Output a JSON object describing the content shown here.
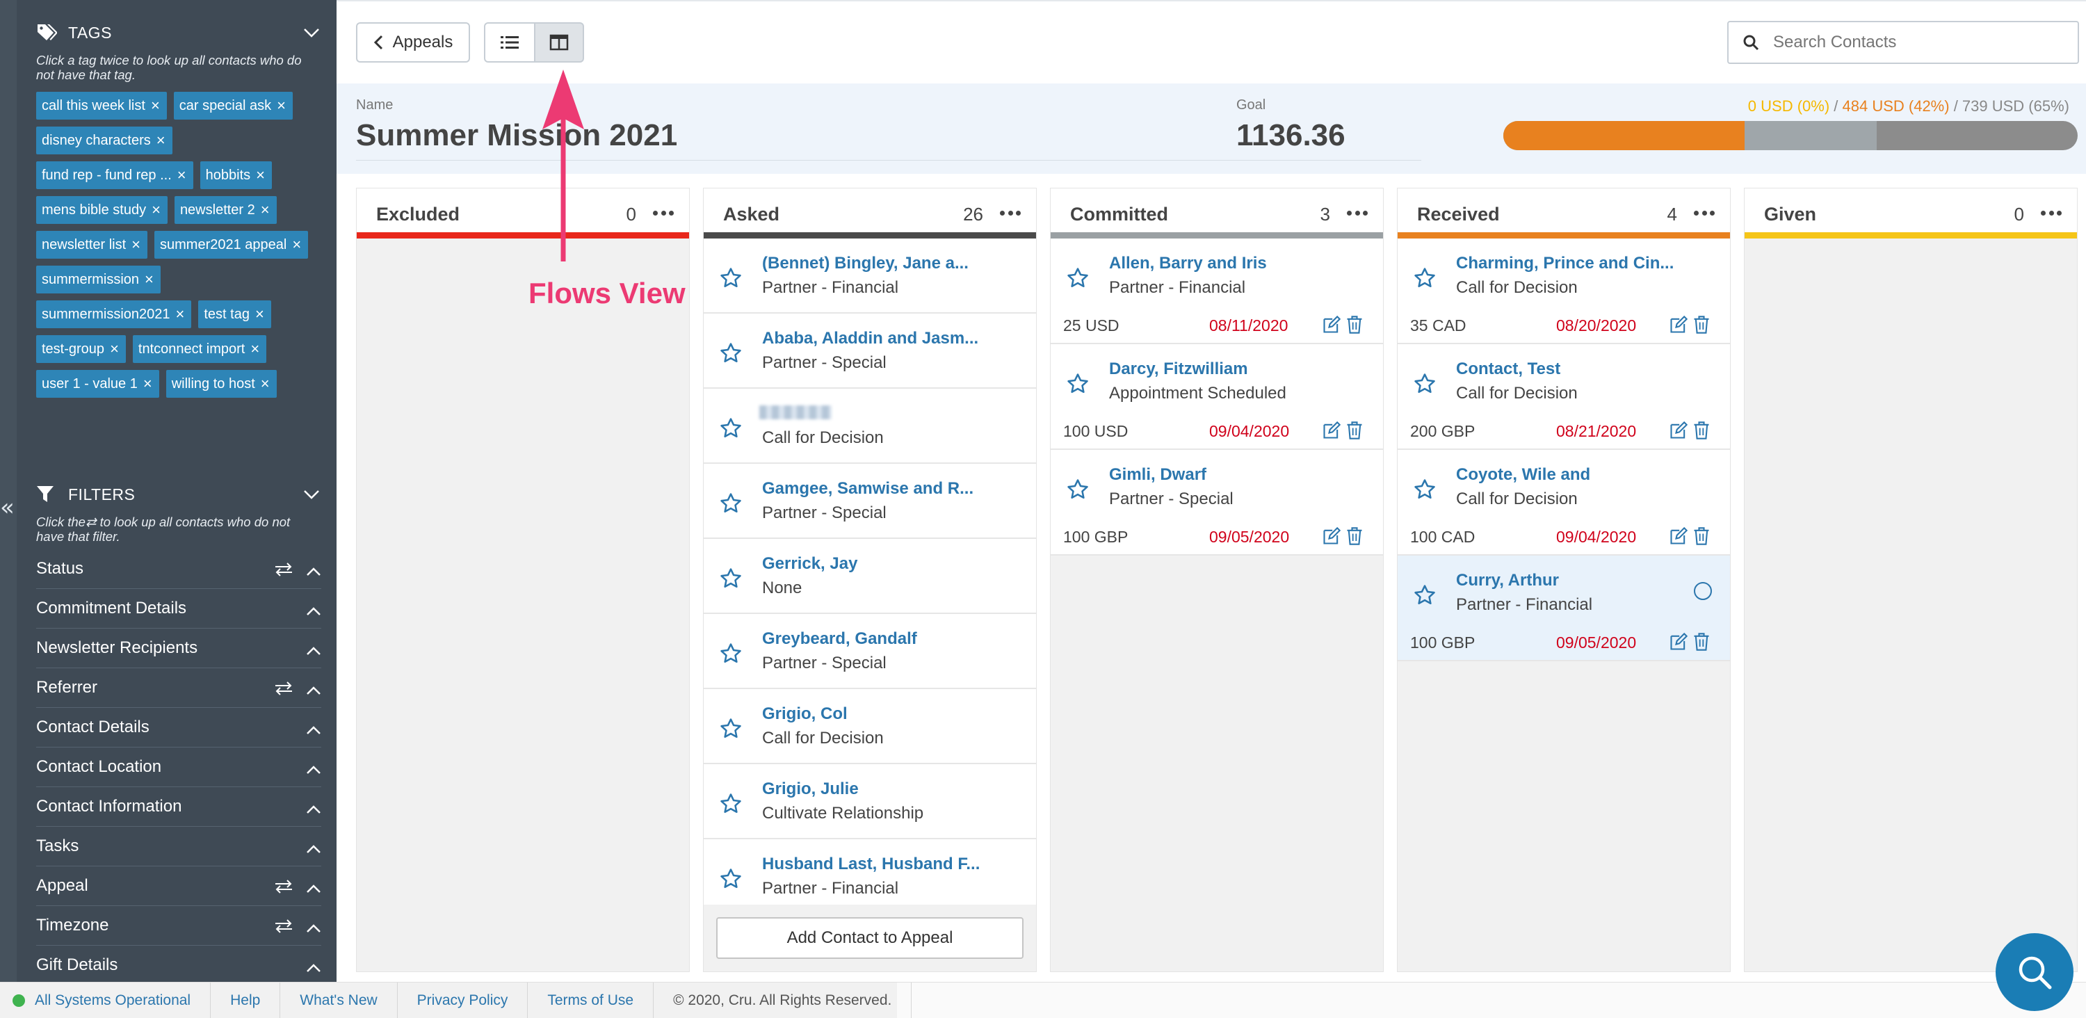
{
  "sidebar": {
    "tags_title": "TAGS",
    "tags_hint": "Click a tag twice to look up all contacts who do not have that tag.",
    "tags": [
      "call this week list",
      "car special ask",
      "disney characters",
      "fund rep - fund rep ...",
      "hobbits",
      "mens bible study",
      "newsletter 2",
      "newsletter list",
      "summer2021 appeal",
      "summermission",
      "summermission2021",
      "test tag",
      "test-group",
      "tntconnect import",
      "user 1 - value 1",
      "willing to host"
    ],
    "filters_title": "FILTERS",
    "filters_hint_prefix": "Click the",
    "filters_hint_suffix": "to look up all contacts who do not have that filter.",
    "filters": [
      {
        "label": "Status",
        "switch": true
      },
      {
        "label": "Commitment Details",
        "switch": false
      },
      {
        "label": "Newsletter Recipients",
        "switch": false
      },
      {
        "label": "Referrer",
        "switch": true
      },
      {
        "label": "Contact Details",
        "switch": false
      },
      {
        "label": "Contact Location",
        "switch": false
      },
      {
        "label": "Contact Information",
        "switch": false
      },
      {
        "label": "Tasks",
        "switch": false
      },
      {
        "label": "Appeal",
        "switch": true
      },
      {
        "label": "Timezone",
        "switch": true
      },
      {
        "label": "Gift Details",
        "switch": false
      }
    ]
  },
  "toolbar": {
    "back_label": "Appeals",
    "search_placeholder": "Search Contacts"
  },
  "appeal": {
    "name_label": "Name",
    "name": "Summer Mission 2021",
    "goal_label": "Goal",
    "goal": "1136.36",
    "progress_given": "0 USD (0%)",
    "progress_received": "484 USD (42%)",
    "progress_committed": "739 USD (65%)",
    "progress_sep": " / ",
    "progress_fractions": {
      "given": 0.0,
      "received": 0.42,
      "committed": 0.65
    },
    "colors": {
      "given": "#f5b800",
      "received": "#e8811f",
      "committed": "#888888"
    }
  },
  "columns": [
    {
      "key": "excluded",
      "title": "Excluded",
      "count": "0",
      "color": "#e8271b",
      "cards": []
    },
    {
      "key": "asked",
      "title": "Asked",
      "count": "26",
      "color": "#4a4a4a",
      "cards": [
        {
          "name": "(Bennet) Bingley, Jane a...",
          "status": "Partner - Financial"
        },
        {
          "name": "Ababa, Aladdin and Jasm...",
          "status": "Partner - Special"
        },
        {
          "name": "",
          "status": "Call for Decision",
          "blurred": true
        },
        {
          "name": "Gamgee, Samwise and R...",
          "status": "Partner - Special"
        },
        {
          "name": "Gerrick, Jay",
          "status": "None"
        },
        {
          "name": "Greybeard, Gandalf",
          "status": "Partner - Special"
        },
        {
          "name": "Grigio, Col",
          "status": "Call for Decision"
        },
        {
          "name": "Grigio, Julie",
          "status": "Cultivate Relationship"
        },
        {
          "name": "Husband Last, Husband F...",
          "status": "Partner - Financial"
        }
      ]
    },
    {
      "key": "committed",
      "title": "Committed",
      "count": "3",
      "color": "#9aa0a3",
      "cards": [
        {
          "name": "Allen, Barry and Iris",
          "status": "Partner - Financial",
          "amount": "25 USD",
          "date": "08/11/2020"
        },
        {
          "name": "Darcy, Fitzwilliam",
          "status": "Appointment Scheduled",
          "amount": "100 USD",
          "date": "09/04/2020"
        },
        {
          "name": "Gimli, Dwarf",
          "status": "Partner - Special",
          "amount": "100 GBP",
          "date": "09/05/2020"
        }
      ]
    },
    {
      "key": "received",
      "title": "Received",
      "count": "4",
      "color": "#e8811f",
      "cards": [
        {
          "name": "Charming, Prince and Cin...",
          "status": "Call for Decision",
          "amount": "35 CAD",
          "date": "08/20/2020"
        },
        {
          "name": "Contact, Test",
          "status": "Call for Decision",
          "amount": "200 GBP",
          "date": "08/21/2020"
        },
        {
          "name": "Coyote, Wile and",
          "status": "Call for Decision",
          "amount": "100 CAD",
          "date": "09/04/2020"
        },
        {
          "name": "Curry, Arthur",
          "status": "Partner - Financial",
          "amount": "100 GBP",
          "date": "09/05/2020",
          "selected": true
        }
      ]
    },
    {
      "key": "given",
      "title": "Given",
      "count": "0",
      "color": "#f5c518",
      "cards": []
    }
  ],
  "add_contact_label": "Add Contact to Appeal",
  "annotation": {
    "label": "Flows View"
  },
  "footer": {
    "status": "All Systems Operational",
    "links": [
      "Help",
      "What's New",
      "Privacy Policy",
      "Terms of Use"
    ],
    "copyright": "© 2020, Cru. All Rights Reserved."
  }
}
